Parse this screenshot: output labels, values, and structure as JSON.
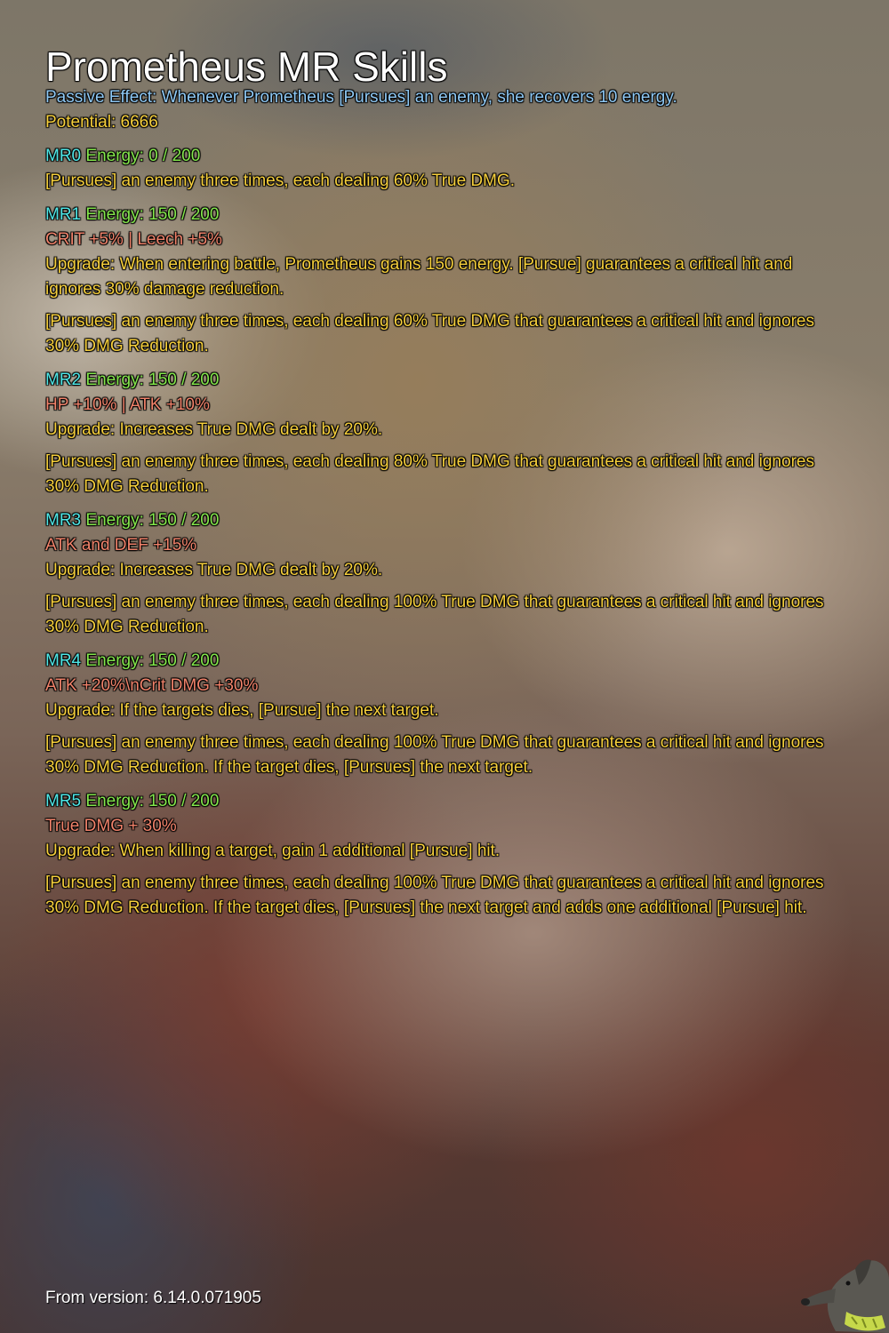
{
  "title": "Prometheus MR Skills",
  "passive": "Passive Effect: Whenever Prometheus [Pursues] an enemy, she recovers 10 energy.",
  "potential": "Potential: 6666",
  "levels": [
    {
      "mr": "MR0",
      "energy": "Energy: 0 / 200",
      "stats": "",
      "upgrade": "",
      "description": "[Pursues] an enemy three times, each dealing 60% True DMG."
    },
    {
      "mr": "MR1",
      "energy": "Energy: 150 / 200",
      "stats": "CRIT +5% | Leech +5%",
      "upgrade": "Upgrade: When entering battle, Prometheus gains 150 energy. [Pursue] guarantees a critical hit and ignores 30% damage reduction.",
      "description": "[Pursues] an enemy three times, each dealing 60% True DMG that guarantees a critical hit and ignores 30% DMG Reduction."
    },
    {
      "mr": "MR2",
      "energy": "Energy: 150 / 200",
      "stats": "HP +10% | ATK +10%",
      "upgrade": "Upgrade: Increases True DMG dealt by 20%.",
      "description": "[Pursues] an enemy three times, each dealing 80% True DMG that guarantees a critical hit and ignores 30% DMG Reduction."
    },
    {
      "mr": "MR3",
      "energy": "Energy: 150 / 200",
      "stats": "ATK and DEF +15%",
      "upgrade": "Upgrade: Increases True DMG dealt by 20%.",
      "description": "[Pursues] an enemy three times, each dealing 100% True DMG that guarantees a critical hit and ignores 30% DMG Reduction."
    },
    {
      "mr": "MR4",
      "energy": "Energy: 150 / 200",
      "stats": "ATK +20%\\nCrit DMG +30%",
      "upgrade": "Upgrade: If the targets dies, [Pursue] the next target.",
      "description": "[Pursues] an enemy three times, each dealing 100% True DMG that guarantees a critical hit and ignores 30% DMG Reduction. If the target dies, [Pursues] the next target."
    },
    {
      "mr": "MR5",
      "energy": "Energy: 150 / 200",
      "stats": "True DMG + 30%",
      "upgrade": "Upgrade: When killing a target, gain 1 additional [Pursue] hit.",
      "description": "[Pursues] an enemy three times, each dealing 100% True DMG that guarantees a critical hit and ignores 30% DMG Reduction. If the target dies, [Pursues] the next target and adds one additional [Pursue] hit."
    }
  ],
  "footer": "From version: 6.14.0.071905",
  "watermark_icon": "dog-icon"
}
